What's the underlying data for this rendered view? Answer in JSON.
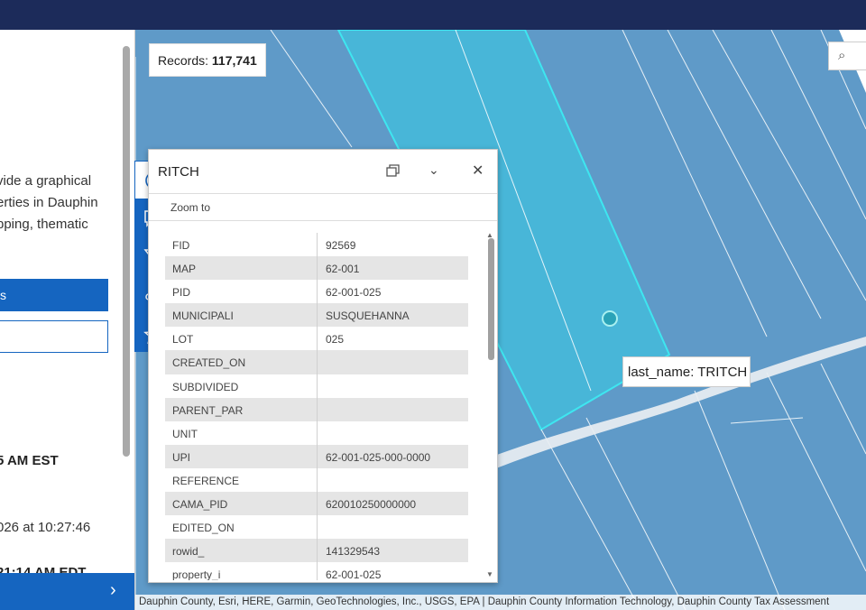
{
  "side_panel": {
    "lines": [
      "vide a graphical",
      "erties in Dauphin",
      "pping, thematic"
    ],
    "time1": "5 AM EST",
    "time2": "026 at 10:27:46",
    "time3": "21:14 AM EDT",
    "primary_button_label": "s"
  },
  "map": {
    "records_label": "Records:",
    "records_value": "117,741",
    "tooltip": "last_name: TRITCH",
    "attribution": "Dauphin County, Esri, HERE, Garmin, GeoTechnologies, Inc., USGS, EPA | Dauphin County Information Technology, Dauphin County Tax Assessment"
  },
  "tools": [
    "info-icon",
    "comment-icon",
    "filter-icon",
    "download-icon",
    "star-icon"
  ],
  "popup": {
    "title": "RITCH",
    "zoom_label": "Zoom to",
    "fields": [
      {
        "key": "FID",
        "value": "92569"
      },
      {
        "key": "MAP",
        "value": "62-001"
      },
      {
        "key": "PID",
        "value": "62-001-025"
      },
      {
        "key": "MUNICIPALI",
        "value": "SUSQUEHANNA"
      },
      {
        "key": "LOT",
        "value": "025"
      },
      {
        "key": "CREATED_ON",
        "value": ""
      },
      {
        "key": "SUBDIVIDED",
        "value": ""
      },
      {
        "key": "PARENT_PAR",
        "value": ""
      },
      {
        "key": "UNIT",
        "value": ""
      },
      {
        "key": "UPI",
        "value": "62-001-025-000-0000"
      },
      {
        "key": "REFERENCE",
        "value": ""
      },
      {
        "key": "CAMA_PID",
        "value": "620010250000000"
      },
      {
        "key": "EDITED_ON",
        "value": ""
      },
      {
        "key": "rowid_",
        "value": "141329543"
      },
      {
        "key": "property_i",
        "value": "62-001-025"
      }
    ]
  },
  "colors": {
    "topbar": "#1c2b5a",
    "accent": "#1565c0",
    "map_fill": "#5f9ac8",
    "selected_parcel": "#48b6d8"
  }
}
